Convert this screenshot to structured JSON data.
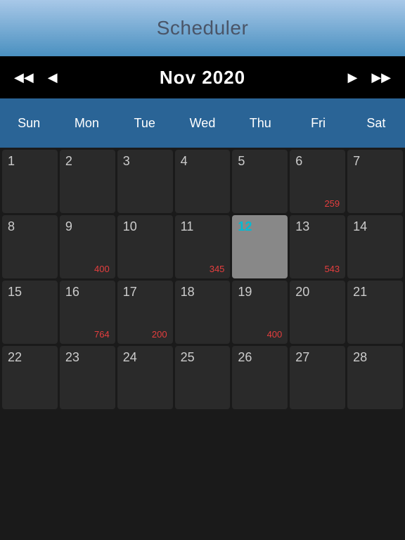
{
  "header": {
    "title": "Scheduler",
    "gradient_top": "#a8c8e8",
    "gradient_bottom": "#4a90c0"
  },
  "nav": {
    "prev_prev_label": "◀◀",
    "prev_label": "◀",
    "next_label": "▶",
    "next_next_label": "▶▶",
    "month_year": "Nov 2020"
  },
  "day_headers": [
    "Sun",
    "Mon",
    "Tue",
    "Wed",
    "Thu",
    "Fri",
    "Sat"
  ],
  "calendar": {
    "weeks": [
      [
        {
          "day": 1,
          "value": null,
          "today": false,
          "empty": false
        },
        {
          "day": 2,
          "value": null,
          "today": false,
          "empty": false
        },
        {
          "day": 3,
          "value": null,
          "today": false,
          "empty": false
        },
        {
          "day": 4,
          "value": null,
          "today": false,
          "empty": false
        },
        {
          "day": 5,
          "value": null,
          "today": false,
          "empty": false
        },
        {
          "day": 6,
          "value": 259,
          "today": false,
          "empty": false
        },
        {
          "day": 7,
          "value": null,
          "today": false,
          "empty": false
        }
      ],
      [
        {
          "day": 8,
          "value": null,
          "today": false,
          "empty": false
        },
        {
          "day": 9,
          "value": 400,
          "today": false,
          "empty": false
        },
        {
          "day": 10,
          "value": null,
          "today": false,
          "empty": false
        },
        {
          "day": 11,
          "value": 345,
          "today": false,
          "empty": false
        },
        {
          "day": 12,
          "value": null,
          "today": true,
          "empty": false
        },
        {
          "day": 13,
          "value": 543,
          "today": false,
          "empty": false
        },
        {
          "day": 14,
          "value": null,
          "today": false,
          "empty": false
        }
      ],
      [
        {
          "day": 15,
          "value": null,
          "today": false,
          "empty": false
        },
        {
          "day": 16,
          "value": 764,
          "today": false,
          "empty": false
        },
        {
          "day": 17,
          "value": 200,
          "today": false,
          "empty": false
        },
        {
          "day": 18,
          "value": null,
          "today": false,
          "empty": false
        },
        {
          "day": 19,
          "value": 400,
          "today": false,
          "empty": false
        },
        {
          "day": 20,
          "value": null,
          "today": false,
          "empty": false
        },
        {
          "day": 21,
          "value": null,
          "today": false,
          "empty": false
        }
      ],
      [
        {
          "day": 22,
          "value": null,
          "today": false,
          "empty": false
        },
        {
          "day": 23,
          "value": null,
          "today": false,
          "empty": false
        },
        {
          "day": 24,
          "value": null,
          "today": false,
          "empty": false
        },
        {
          "day": 25,
          "value": null,
          "today": false,
          "empty": false
        },
        {
          "day": 26,
          "value": null,
          "today": false,
          "empty": false
        },
        {
          "day": 27,
          "value": null,
          "today": false,
          "empty": false
        },
        {
          "day": 28,
          "value": null,
          "today": false,
          "empty": false
        }
      ]
    ]
  }
}
